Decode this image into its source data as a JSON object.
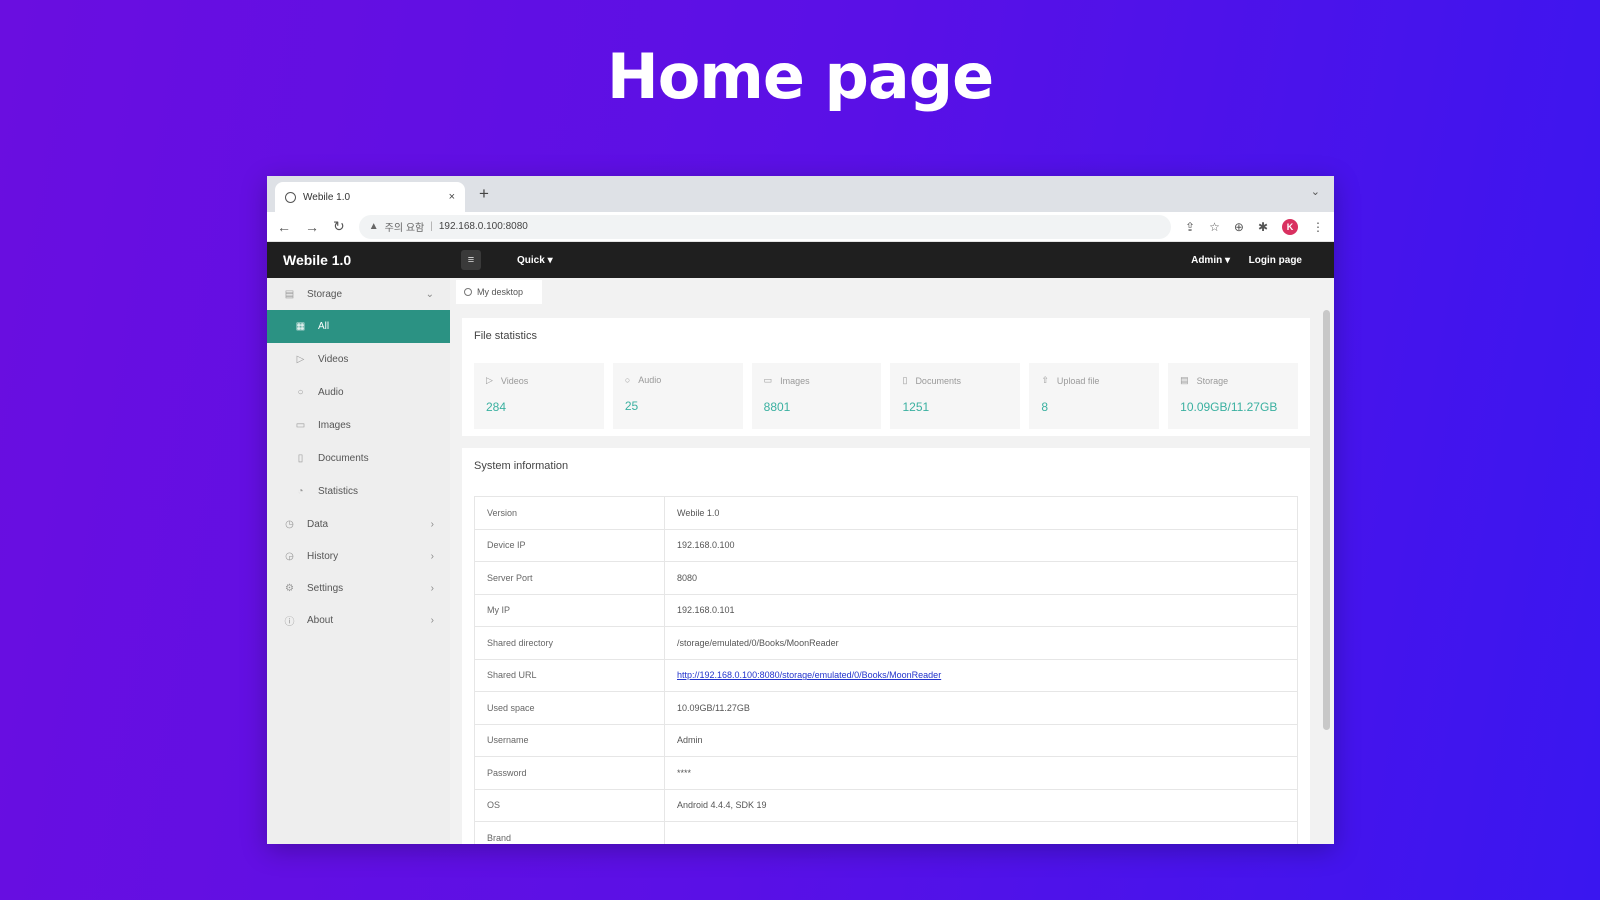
{
  "hero": {
    "title": "Home page"
  },
  "browser": {
    "tab_title": "Webile 1.0",
    "new_tab_label": "+",
    "close_label": "×",
    "tabs_menu_label": "⌄",
    "back_label": "←",
    "forward_label": "→",
    "reload_label": "↻",
    "security_label": "주의 요함",
    "address": "192.168.0.100:8080",
    "profile_initial": "K"
  },
  "app": {
    "logo": "Webile 1.0",
    "menu_icon": "≡",
    "quick_menu": "Quick ▾",
    "admin_menu": "Admin ▾",
    "login_link": "Login page"
  },
  "sidebar": {
    "storage": {
      "label": "Storage",
      "icon": "storage-icon"
    },
    "storage_items": [
      {
        "label": "All",
        "icon": "grid-icon",
        "active": true
      },
      {
        "label": "Videos",
        "icon": "video-icon"
      },
      {
        "label": "Audio",
        "icon": "audio-icon"
      },
      {
        "label": "Images",
        "icon": "image-icon"
      },
      {
        "label": "Documents",
        "icon": "document-icon"
      },
      {
        "label": "Statistics",
        "icon": "statistics-icon"
      }
    ],
    "groups": [
      {
        "label": "Data",
        "icon": "data-icon"
      },
      {
        "label": "History",
        "icon": "history-icon"
      },
      {
        "label": "Settings",
        "icon": "settings-icon"
      },
      {
        "label": "About",
        "icon": "about-icon"
      }
    ]
  },
  "page_tab": {
    "label": "My desktop"
  },
  "file_stats": {
    "title": "File statistics",
    "items": [
      {
        "label": "Videos",
        "value": "284",
        "icon": "video-icon"
      },
      {
        "label": "Audio",
        "value": "25",
        "icon": "audio-icon"
      },
      {
        "label": "Images",
        "value": "8801",
        "icon": "image-icon"
      },
      {
        "label": "Documents",
        "value": "1251",
        "icon": "document-icon"
      },
      {
        "label": "Upload file",
        "value": "8",
        "icon": "upload-icon"
      },
      {
        "label": "Storage",
        "value": "10.09GB/11.27GB",
        "icon": "storage-icon"
      }
    ]
  },
  "system_info": {
    "title": "System information",
    "rows": [
      {
        "key": "Version",
        "value": "Webile 1.0"
      },
      {
        "key": "Device IP",
        "value": "192.168.0.100"
      },
      {
        "key": "Server Port",
        "value": "8080"
      },
      {
        "key": "My IP",
        "value": "192.168.0.101"
      },
      {
        "key": "Shared directory",
        "value": "/storage/emulated/0/Books/MoonReader"
      },
      {
        "key": "Shared URL",
        "value": "http://192.168.0.100:8080/storage/emulated/0/Books/MoonReader",
        "link": true
      },
      {
        "key": "Used space",
        "value": "10.09GB/11.27GB"
      },
      {
        "key": "Username",
        "value": "Admin"
      },
      {
        "key": "Password",
        "value": "****"
      },
      {
        "key": "OS",
        "value": "Android 4.4.4, SDK 19"
      },
      {
        "key": "Brand",
        "value": ""
      }
    ]
  }
}
